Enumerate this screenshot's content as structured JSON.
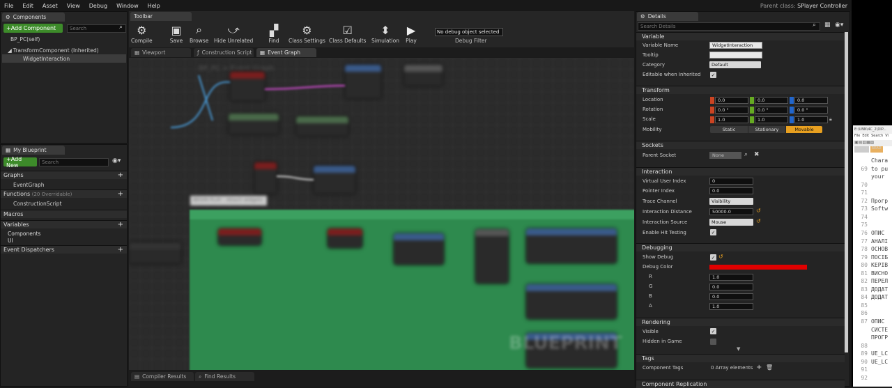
{
  "menu": {
    "items": [
      "File",
      "Edit",
      "Asset",
      "View",
      "Debug",
      "Window",
      "Help"
    ],
    "parent_label": "Parent class:",
    "parent_value": "SPlayer Controller"
  },
  "components": {
    "tab": "Components",
    "add": "+Add Component",
    "search_placeholder": "Search",
    "self": "BP_PC(self)",
    "tree": [
      "TransformComponent (Inherited)",
      "WidgetInteraction"
    ]
  },
  "blueprint": {
    "tab": "My Blueprint",
    "add": "+Add New",
    "search_placeholder": "Search",
    "graphs_label": "Graphs",
    "event_graph": "EventGraph",
    "functions_label": "Functions",
    "functions_count": "(20 Overridable)",
    "construction": "ConstructionScript",
    "macros": "Macros",
    "variables": "Variables",
    "var_items": [
      "Components",
      "UI"
    ],
    "dispatchers": "Event Dispatchers"
  },
  "toolbar": {
    "tab": "Toolbar",
    "buttons": [
      "Compile",
      "Save",
      "Browse",
      "Hide Unrelated",
      "Find",
      "Class Settings",
      "Class Defaults",
      "Simulation",
      "Play"
    ],
    "debug_select": "No debug object selected",
    "debug_filter": "Debug Filter"
  },
  "editor_tabs": [
    "Viewport",
    "Construction Script",
    "Event Graph"
  ],
  "graph": {
    "breadcrumb": "BP_PC > Event Graph",
    "comment": "BEGIN PLAY : Attach widgets",
    "watermark": "BLUEPRINT"
  },
  "bottom_tabs": [
    "Compiler Results",
    "Find Results"
  ],
  "details": {
    "tab": "Details",
    "search_placeholder": "Search Details",
    "variable": {
      "head": "Variable",
      "name_label": "Variable Name",
      "name": "WidgetInteraction",
      "tooltip_label": "Tooltip",
      "category_label": "Category",
      "category": "Default",
      "editable_label": "Editable when Inherited"
    },
    "transform": {
      "head": "Transform",
      "location_label": "Location",
      "rotation_label": "Rotation",
      "scale_label": "Scale",
      "mobility_label": "Mobility",
      "location": [
        "0.0",
        "0.0",
        "0.0"
      ],
      "rotation": [
        "0.0 °",
        "0.0 °",
        "0.0 °"
      ],
      "scale": [
        "1.0",
        "1.0",
        "1.0"
      ],
      "mobility": [
        "Static",
        "Stationary",
        "Movable"
      ]
    },
    "sockets": {
      "head": "Sockets",
      "parent_label": "Parent Socket",
      "parent": "None"
    },
    "interaction": {
      "head": "Interaction",
      "vui_label": "Virtual User Index",
      "vui": "0",
      "pi_label": "Pointer Index",
      "pi": "0.0",
      "tc_label": "Trace Channel",
      "tc": "Visibility",
      "dist_label": "Interaction Distance",
      "dist": "50000.0",
      "src_label": "Interaction Source",
      "src": "Mouse",
      "hit_label": "Enable Hit Testing"
    },
    "debugging": {
      "head": "Debugging",
      "show_label": "Show Debug",
      "color_label": "Debug Color",
      "color_hex": "#e00000",
      "r_label": "R",
      "g_label": "G",
      "b_label": "B",
      "a_label": "A",
      "r": "1.0",
      "g": "0.0",
      "b": "0.0",
      "a": "1.0"
    },
    "rendering": {
      "head": "Rendering",
      "visible_label": "Visible",
      "hidden_label": "Hidden in Game"
    },
    "tags": {
      "head": "Tags",
      "ct_label": "Component Tags",
      "ct": "0 Array elements"
    },
    "replication": {
      "head": "Component Replication"
    }
  },
  "side_window": {
    "title": "E:\\UNN\\4C_2\\DIP...",
    "menu": [
      "File",
      "Edit",
      "Search",
      "Vi"
    ],
    "tabs": [
      "Note 1",
      "READ"
    ]
  },
  "code_lines": [
    {
      "n": "",
      "t": "Chara"
    },
    {
      "n": "69",
      "t": "to pu"
    },
    {
      "n": "",
      "t": "your"
    },
    {
      "n": "70",
      "t": ""
    },
    {
      "n": "71",
      "t": ""
    },
    {
      "n": "72",
      "t": "Прогр"
    },
    {
      "n": "73",
      "t": "Softw"
    },
    {
      "n": "74",
      "t": ""
    },
    {
      "n": "75",
      "t": ""
    },
    {
      "n": "76",
      "t": "ОПИС"
    },
    {
      "n": "77",
      "t": "АНАЛІ"
    },
    {
      "n": "78",
      "t": "ОСНОВ"
    },
    {
      "n": "79",
      "t": "ПОСІБ"
    },
    {
      "n": "80",
      "t": "КЕРІВ"
    },
    {
      "n": "81",
      "t": "ВИСНО"
    },
    {
      "n": "82",
      "t": "ПЕРЕЛ"
    },
    {
      "n": "83",
      "t": "ДОДАТ"
    },
    {
      "n": "84",
      "t": "ДОДАТ"
    },
    {
      "n": "85",
      "t": ""
    },
    {
      "n": "86",
      "t": ""
    },
    {
      "n": "87",
      "t": "ОПИС"
    },
    {
      "n": "",
      "t": "СИСТЕ"
    },
    {
      "n": "",
      "t": "ПРОГР"
    },
    {
      "n": "88",
      "t": ""
    },
    {
      "n": "89",
      "t": "UE_LC"
    },
    {
      "n": "90",
      "t": "UE_LC"
    },
    {
      "n": "91",
      "t": ""
    },
    {
      "n": "92",
      "t": ""
    }
  ]
}
